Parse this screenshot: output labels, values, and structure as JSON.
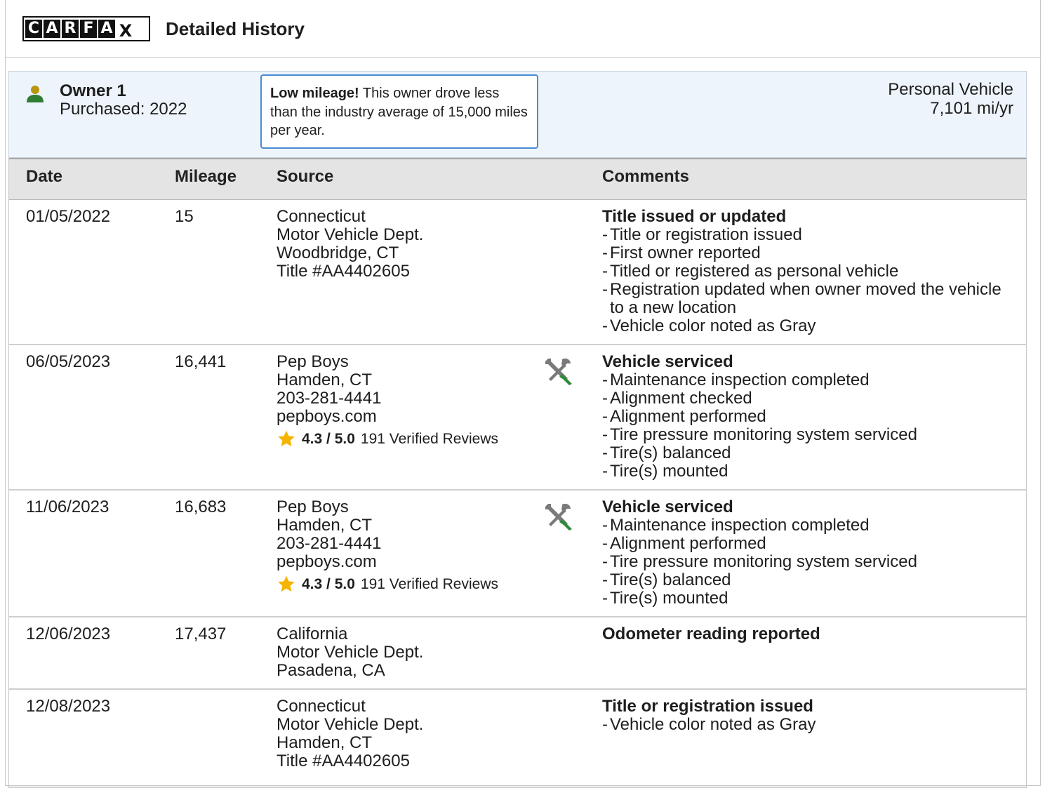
{
  "header": {
    "logo_letters": [
      "C",
      "A",
      "R",
      "F",
      "A",
      "X"
    ],
    "title": "Detailed History"
  },
  "owner": {
    "name": "Owner 1",
    "purchased": "Purchased: 2022",
    "callout_bold": "Low mileage!",
    "callout_text": "This owner drove less than the industry average of 15,000 miles per year.",
    "vehicle_type": "Personal Vehicle",
    "annual_miles": "7,101 mi/yr"
  },
  "table": {
    "columns": [
      "Date",
      "Mileage",
      "Source",
      "Comments"
    ],
    "rows": [
      {
        "date": "01/05/2022",
        "mileage": "15",
        "source": [
          "Connecticut",
          "Motor Vehicle Dept.",
          "Woodbridge, CT",
          "Title #AA4402605"
        ],
        "comment_title": "Title issued or updated",
        "comments": [
          "Title or registration issued",
          "First owner reported",
          "Titled or registered as personal vehicle",
          "Registration updated when owner moved the vehicle to a new location",
          "Vehicle color noted as Gray"
        ]
      },
      {
        "date": "06/05/2023",
        "mileage": "16,441",
        "source": [
          "Pep Boys",
          "Hamden, CT",
          "203-281-4441",
          "pepboys.com"
        ],
        "rating": "4.3 / 5.0",
        "reviews": "191 Verified Reviews",
        "icon": "wrench-screwdriver-icon",
        "comment_title": "Vehicle serviced",
        "comments": [
          "Maintenance inspection completed",
          "Alignment checked",
          "Alignment performed",
          "Tire pressure monitoring system serviced",
          "Tire(s) balanced",
          "Tire(s) mounted"
        ]
      },
      {
        "date": "11/06/2023",
        "mileage": "16,683",
        "source": [
          "Pep Boys",
          "Hamden, CT",
          "203-281-4441",
          "pepboys.com"
        ],
        "rating": "4.3 / 5.0",
        "reviews": "191 Verified Reviews",
        "icon": "wrench-screwdriver-icon",
        "comment_title": "Vehicle serviced",
        "comments": [
          "Maintenance inspection completed",
          "Alignment performed",
          "Tire pressure monitoring system serviced",
          "Tire(s) balanced",
          "Tire(s) mounted"
        ]
      },
      {
        "date": "12/06/2023",
        "mileage": "17,437",
        "source": [
          "California",
          "Motor Vehicle Dept.",
          "Pasadena, CA"
        ],
        "comment_title": "Odometer reading reported",
        "comments": []
      },
      {
        "date": "12/08/2023",
        "mileage": "",
        "source": [
          "Connecticut",
          "Motor Vehicle Dept.",
          "Hamden, CT",
          "Title #AA4402605"
        ],
        "comment_title": "Title or registration issued",
        "comments": [
          "Vehicle color noted as Gray"
        ]
      }
    ]
  },
  "colors": {
    "owner_panel_bg": "#edf4fb",
    "callout_border": "#4a8bd2",
    "person_icon_head": "#b8960c",
    "person_icon_body": "#2e7d32",
    "tool_gray": "#7a7a7a",
    "tool_green": "#2e8b3a",
    "star": "#f4b400"
  }
}
